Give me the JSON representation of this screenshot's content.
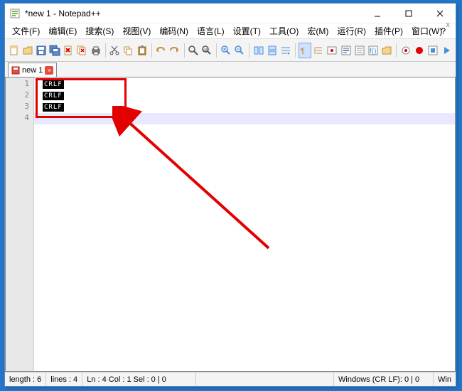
{
  "title": "*new 1 - Notepad++",
  "menu": {
    "file": "文件(F)",
    "edit": "编辑(E)",
    "search": "搜索(S)",
    "view": "视图(V)",
    "encoding": "编码(N)",
    "lang": "语言(L)",
    "settings": "设置(T)",
    "tools": "工具(O)",
    "macro": "宏(M)",
    "run": "运行(R)",
    "plugins": "插件(P)",
    "window": "窗口(W)",
    "help": "?"
  },
  "tab": {
    "label": "new 1",
    "close": "×"
  },
  "lines": {
    "count": 4,
    "crlf": "CRLF",
    "ln1": "1",
    "ln2": "2",
    "ln3": "3",
    "ln4": "4"
  },
  "status": {
    "length": "length : 6",
    "lines_count": "lines : 4",
    "position": "Ln : 4    Col : 1    Sel : 0 | 0",
    "eol": "Windows (CR LF):  0 | 0",
    "enc": "Win"
  },
  "icons": {
    "app_colors": {
      "top": "#e74c3c",
      "mid": "#2ecc71",
      "bot": "#3498db"
    }
  }
}
